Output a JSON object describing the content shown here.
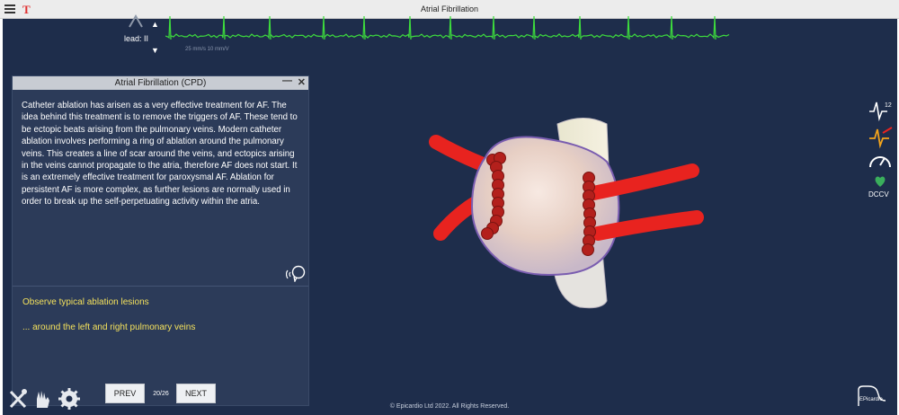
{
  "window": {
    "title": "Atrial Fibrillation",
    "t_icon": "T"
  },
  "ecg": {
    "lead_label": "lead: II",
    "scale_text": "25 mm/s   10 mm/V",
    "trace_color": "#3ddc3d"
  },
  "panel": {
    "title": "Atrial Fibrillation (CPD)",
    "minimize_glyph": "—",
    "close_glyph": "✕",
    "body_text": "Catheter ablation has arisen as a very effective treatment for AF. The idea behind this treatment is to remove the triggers of AF. These tend to be ectopic beats arising from the pulmonary veins.  Modern catheter ablation involves performing a ring of ablation around the pulmonary veins.  This creates a line of scar around the veins, and ectopics arising in the veins cannot propagate to the atria, therefore AF does not start.  It is an extremely effective treatment for paroxysmal AF.  Ablation for persistent AF is more complex, as further lesions are normally used in order to break up the self-perpetuating activity within the atria.",
    "steps": [
      "Observe typical ablation lesions",
      "... around the left and right pulmonary veins"
    ]
  },
  "navigation": {
    "prev_label": "PREV",
    "next_label": "NEXT",
    "page": "20/26"
  },
  "side_tools": {
    "dccv_label": "DCCV"
  },
  "footer": {
    "copyright": "© Epicardio Ltd 2022. All Rights Reserved.",
    "logo_text": "EPicardio"
  },
  "colors": {
    "stage_bg": "#1e2d4b",
    "panel_bg": "#2c3b59",
    "step_text": "#f4e15c",
    "veins": "#e8231f",
    "lesions": "#b3201c"
  }
}
